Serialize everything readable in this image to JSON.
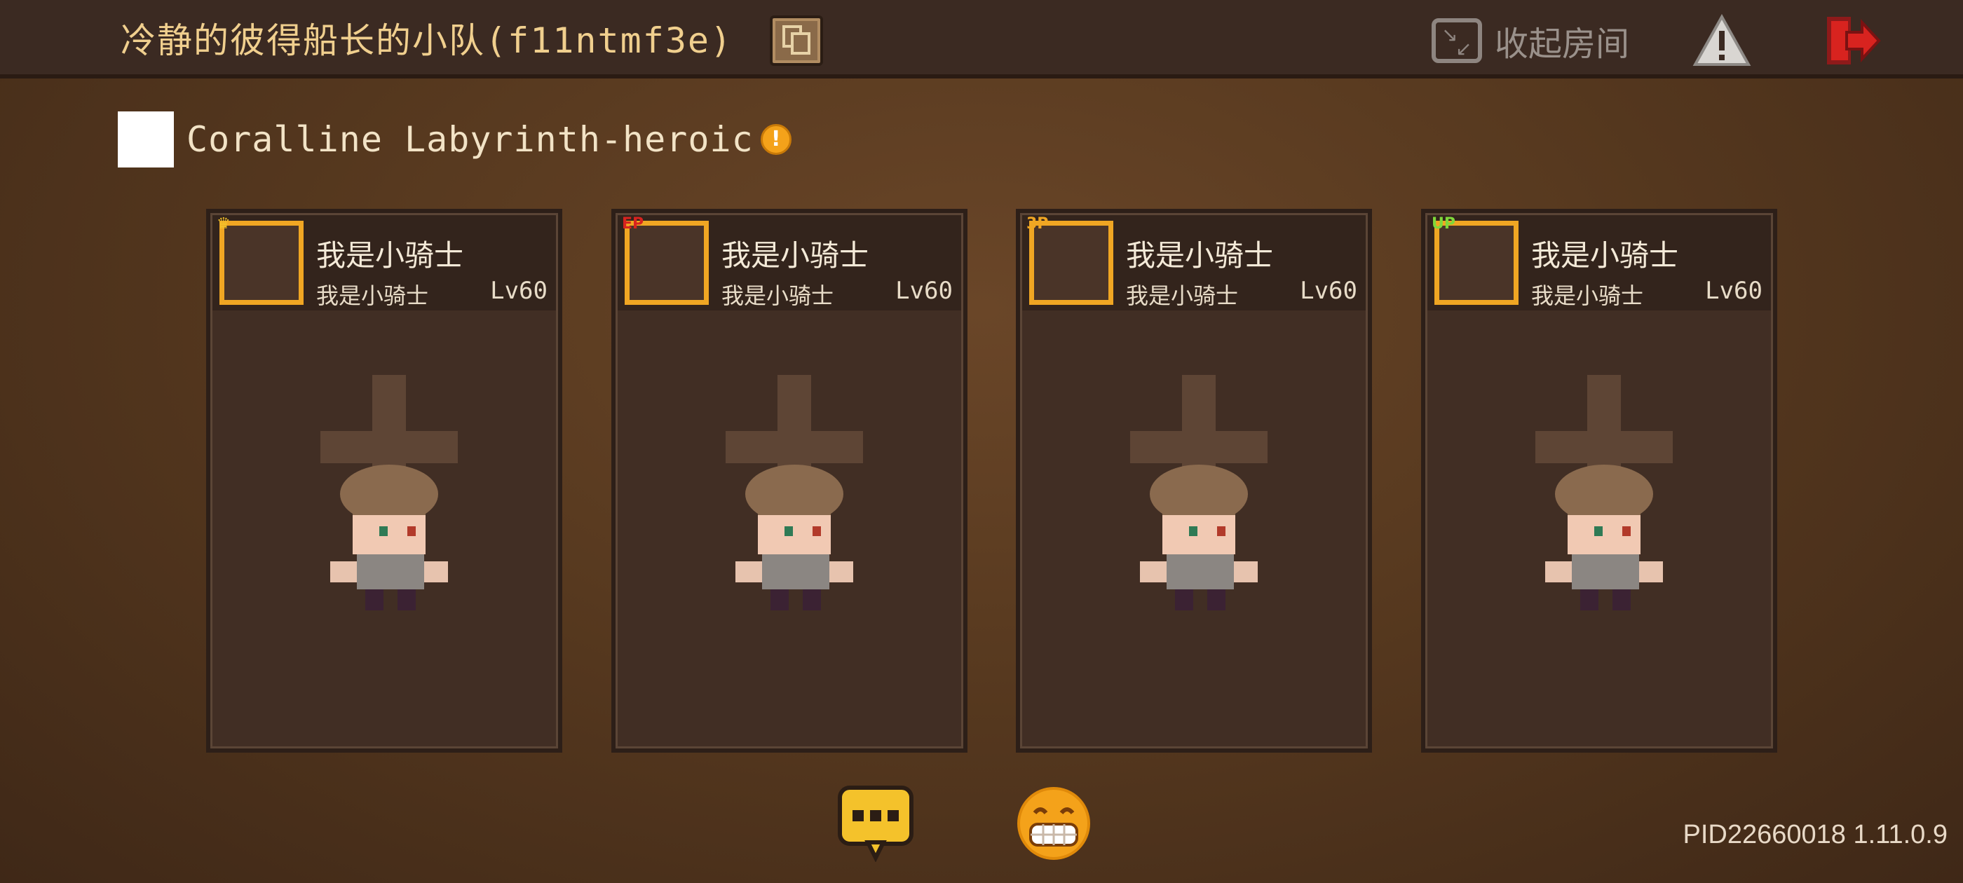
{
  "topbar": {
    "team_title": "冷静的彼得船长的小队(f11ntmf3e)",
    "copy_icon": "copy-icon",
    "collapse_label": "收起房间",
    "collapse_icon": "collapse-icon",
    "warning_icon": "warning-icon",
    "exit_icon": "exit-icon"
  },
  "dungeon": {
    "name": "Coralline Labyrinth-heroic",
    "alert_glyph": "!"
  },
  "cards": [
    {
      "badge": "♛",
      "badge_color": "#f3c12a",
      "name": "我是小骑士",
      "sub": "我是小骑士",
      "level": "Lv60"
    },
    {
      "badge": "EP",
      "badge_color": "#d8231f",
      "name": "我是小骑士",
      "sub": "我是小骑士",
      "level": "Lv60"
    },
    {
      "badge": "3P",
      "badge_color": "#f0a623",
      "name": "我是小骑士",
      "sub": "我是小骑士",
      "level": "Lv60"
    },
    {
      "badge": "UP",
      "badge_color": "#7fd83a",
      "name": "我是小骑士",
      "sub": "我是小骑士",
      "level": "Lv60"
    }
  ],
  "bottom": {
    "chat_icon": "chat-bubble-icon",
    "emoji_icon": "grin-emoji-icon",
    "version": "PID22660018 1.11.0.9"
  },
  "colors": {
    "accent_gold": "#f0a623",
    "title_text": "#f0cf8e",
    "exit_red": "#d8231f"
  }
}
